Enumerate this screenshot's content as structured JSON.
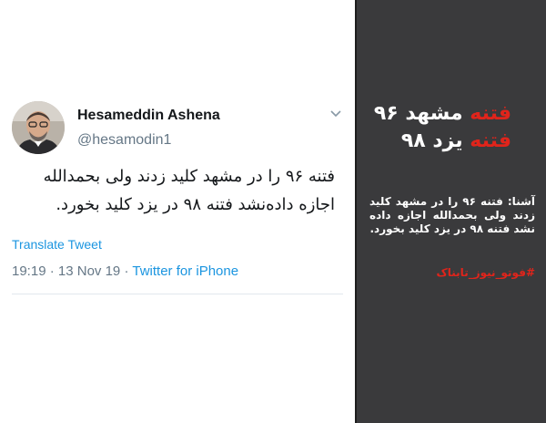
{
  "tweet": {
    "display_name": "Hesameddin Ashena",
    "handle": "@hesamodin1",
    "text": "فتنه ۹۶ را در مشهد کلید زدند ولی بحمدالله اجازه داده‌نشد فتنه ۹۸ در یزد کلید بخورد.",
    "translate_label": "Translate Tweet",
    "time": "19:19",
    "separator": "·",
    "date": "13 Nov 19",
    "source": "Twitter for iPhone"
  },
  "side_panel": {
    "headline_line1": {
      "red": "فتنه",
      "white": "مشهد ۹۶"
    },
    "headline_line2": {
      "red": "فتنه",
      "white": "یزد ۹۸"
    },
    "quote": "آشنا: فتنه ۹۶ را در مشهد کلید زدند ولی بحمدالله اجازه داده نشد فتنه ۹۸ در یزد کلید بخورد.",
    "hashtag": "#فوتو_نیوز_تابناک"
  },
  "colors": {
    "link_blue": "#1b95e0",
    "side_background": "#3a3a3c",
    "accent_red": "#e0241b"
  },
  "icons": {
    "avatar": "profile-photo",
    "menu": "chevron-down-icon"
  }
}
